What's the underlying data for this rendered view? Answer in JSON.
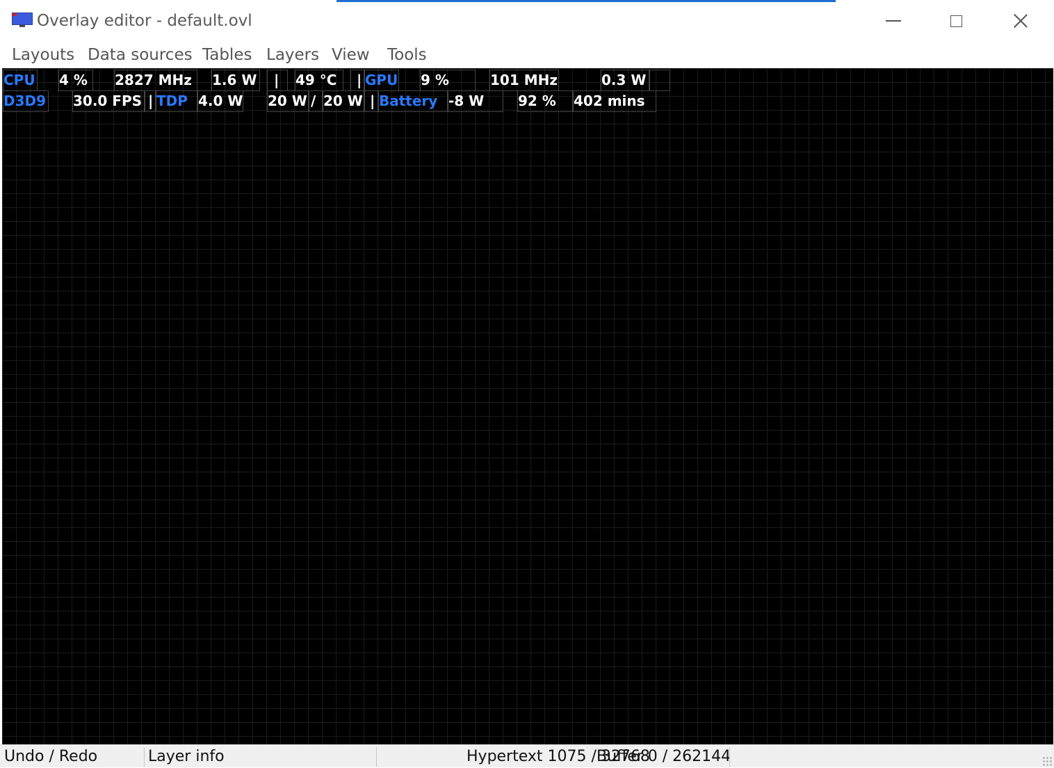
{
  "window": {
    "title": "Overlay editor - default.ovl",
    "accent_color": "#1f6fd0"
  },
  "icons": {
    "app": "monitor-icon",
    "minimize": "minimize-icon",
    "maximize": "maximize-icon",
    "close": "close-icon",
    "grip": "resize-grip-icon"
  },
  "menu": {
    "items": [
      "Layouts",
      "Data sources",
      "Tables",
      "Layers",
      "View",
      "Tools"
    ]
  },
  "overlay": {
    "label_color": "#2979ff",
    "value_color": "#ffffff",
    "row1": [
      "CPU",
      "4 %",
      "2827 MHz",
      "1.6 W",
      "|",
      "49 °C",
      "|",
      "GPU",
      "9 %",
      "101 MHz",
      "0.3 W"
    ],
    "row2": [
      "D3D9",
      "30.0 FPS",
      "|",
      "TDP",
      "4.0 W",
      "20 W",
      "/",
      "20 W",
      "|",
      "Battery",
      "-8 W",
      "92 %",
      "402 mins"
    ]
  },
  "status": {
    "undo_redo": "Undo / Redo",
    "layer_info": "Layer info",
    "hypertext": "Hypertext 1075 / 32768",
    "buffer": "Buffer 0 / 262144"
  }
}
